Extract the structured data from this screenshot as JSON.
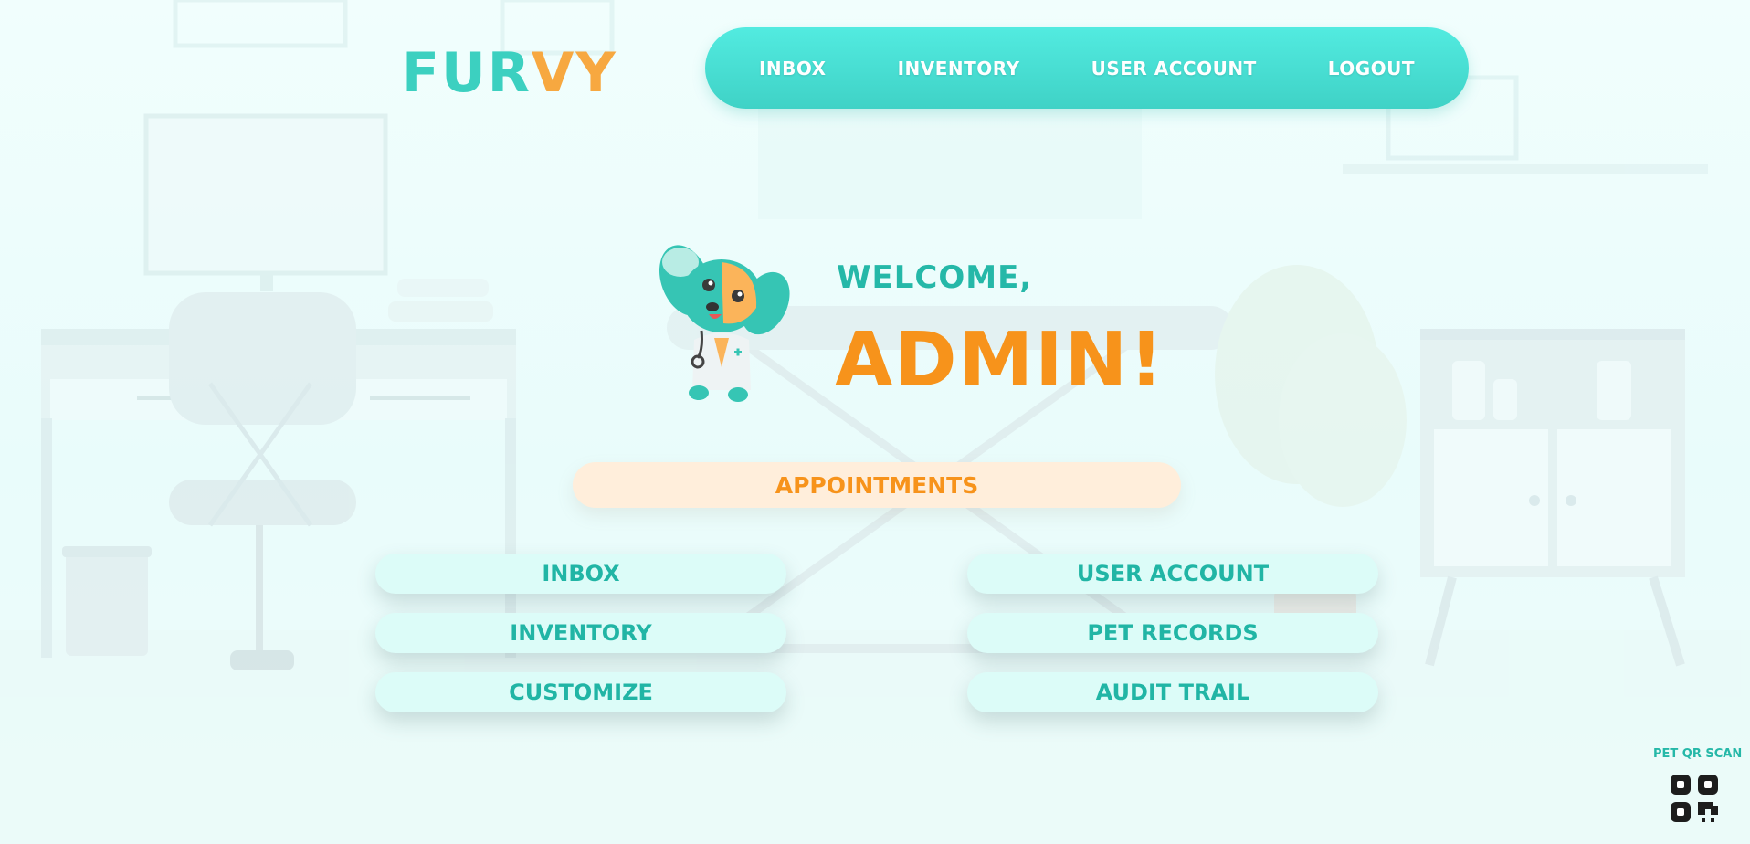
{
  "brand": {
    "logo_part1": "FUR",
    "logo_part2": "VY"
  },
  "topnav": {
    "items": [
      {
        "label": "INBOX"
      },
      {
        "label": "INVENTORY"
      },
      {
        "label": "USER ACCOUNT"
      },
      {
        "label": "LOGOUT"
      }
    ]
  },
  "welcome": {
    "greeting": "WELCOME,",
    "name": "ADMIN!"
  },
  "appointments_button": "APPOINTMENTS",
  "menu": {
    "left": [
      {
        "label": "INBOX"
      },
      {
        "label": "INVENTORY"
      },
      {
        "label": "CUSTOMIZE"
      }
    ],
    "right": [
      {
        "label": "USER ACCOUNT"
      },
      {
        "label": "PET RECORDS"
      },
      {
        "label": "AUDIT TRAIL"
      }
    ]
  },
  "qr": {
    "label": "PET QR SCAN",
    "icon": "qr-code-icon"
  },
  "colors": {
    "teal": "#3fd2c6",
    "teal_text": "#25b8a8",
    "orange": "#f7931b",
    "appointment_bg": "#ffeedb",
    "pill_bg": "#dcfcf8"
  }
}
